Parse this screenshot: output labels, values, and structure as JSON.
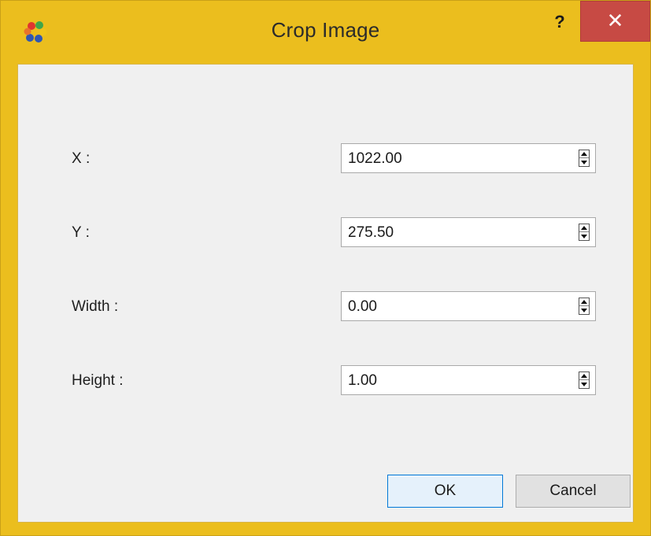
{
  "window": {
    "title": "Crop Image",
    "help_label": "?",
    "close_label": "✕"
  },
  "fields": [
    {
      "label": "X :",
      "value": "1022.00"
    },
    {
      "label": "Y :",
      "value": "275.50"
    },
    {
      "label": "Width :",
      "value": "0.00"
    },
    {
      "label": "Height :",
      "value": "1.00"
    }
  ],
  "buttons": {
    "ok_label": "OK",
    "cancel_label": "Cancel"
  },
  "icons": {
    "app": "app-flower-icon",
    "spin_up": "spin-up-arrow-icon",
    "spin_down": "spin-down-arrow-icon"
  },
  "colors": {
    "frame": "#ebbe1e",
    "close_button": "#c74a44",
    "client_background": "#f0f0f0",
    "ok_focus_border": "#0078d7"
  }
}
